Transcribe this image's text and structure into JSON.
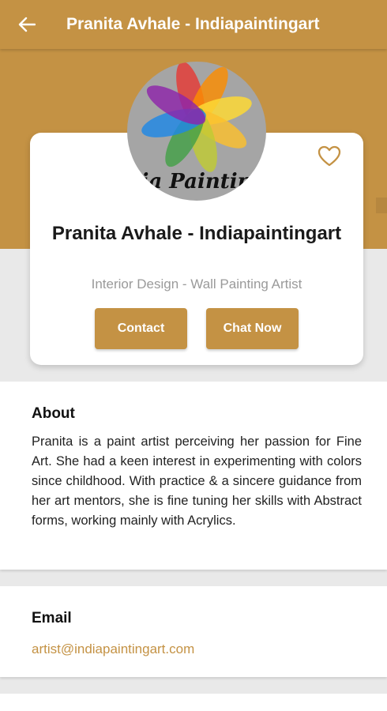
{
  "appbar": {
    "title": "Pranita Avhale - Indiapaintingart"
  },
  "profile": {
    "name": "Pranita Avhale - Indiapaintingart",
    "category": "Interior Design - Wall Painting Artist",
    "logo_text": "ia Paintin",
    "contact_label": "Contact",
    "chat_label": "Chat Now"
  },
  "about": {
    "title": "About",
    "text": "Pranita is a paint artist perceiving her passion for Fine Art. She had a keen interest in experimenting with colors since childhood. With practice & a sincere guidance from her art mentors, she is fine tuning her skills with Abstract forms, working mainly with Acrylics."
  },
  "email": {
    "title": "Email",
    "value": "artist@indiapaintingart.com"
  },
  "colors": {
    "primary": "#c49244",
    "background": "#e9e9e9"
  },
  "icons": {
    "back": "arrow-back-icon",
    "favorite": "heart-outline-icon"
  }
}
